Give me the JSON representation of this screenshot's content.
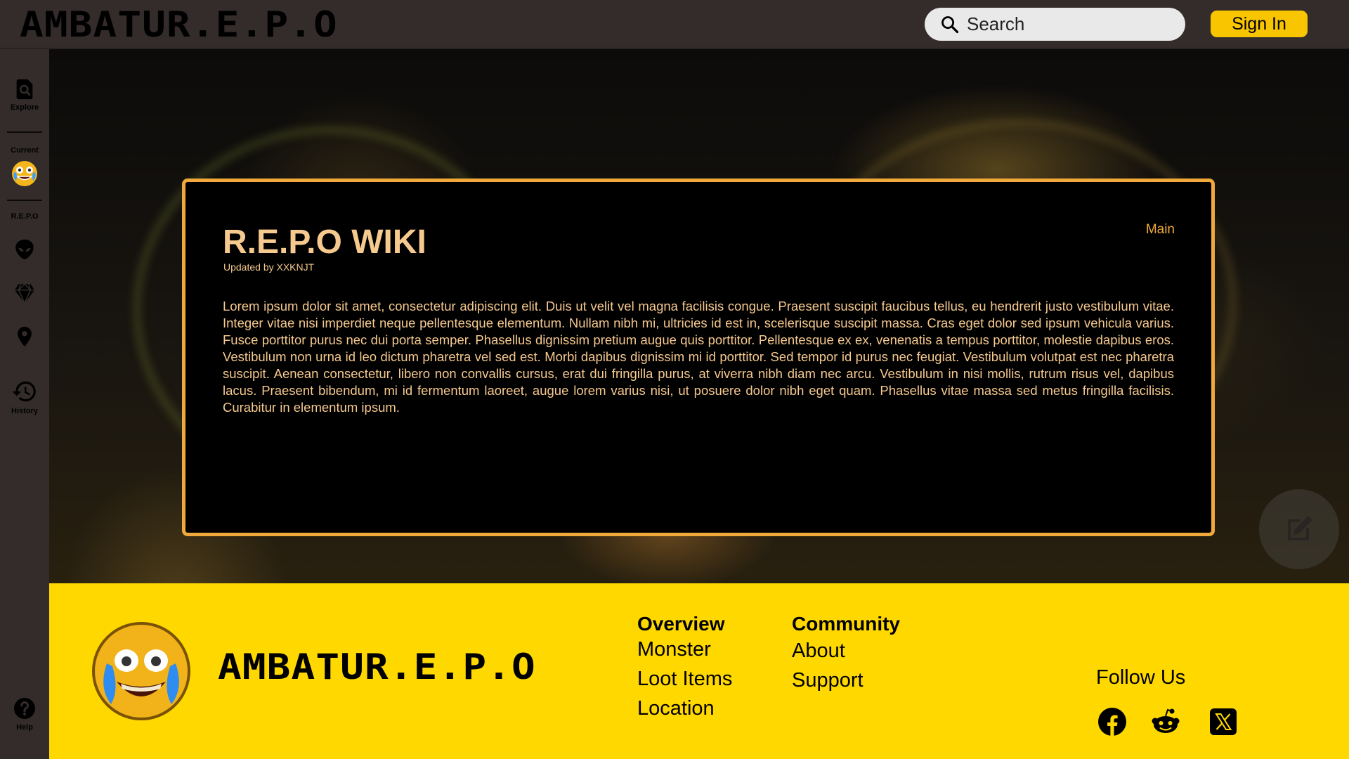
{
  "header": {
    "logo": "AMBATUR.E.P.O",
    "search_placeholder": "Search",
    "signin_label": "Sign In"
  },
  "sidebar": {
    "explore_label": "Explore",
    "current_heading": "Current",
    "repo_heading": "R.E.P.O",
    "history_label": "History",
    "help_label": "Help",
    "icons": [
      "search-icon",
      "crying-laughing-emoji",
      "alien-icon",
      "gem-icon",
      "location-pin-icon",
      "history-icon",
      "help-icon"
    ]
  },
  "wiki": {
    "title": "R.E.P.O WIKI",
    "updated_by": "Updated by XXKNJT",
    "tag": "Main",
    "body": "Lorem ipsum dolor sit amet, consectetur adipiscing elit. Duis ut velit vel magna facilisis congue. Praesent suscipit faucibus tellus, eu hendrerit justo vestibulum vitae. Integer vitae nisi imperdiet neque pellentesque elementum. Nullam nibh mi, ultricies id est in, scelerisque suscipit massa. Cras eget dolor sed ipsum vehicula varius. Fusce porttitor purus nec dui porta semper. Phasellus dignissim pretium augue quis porttitor. Pellentesque ex ex, venenatis a tempus porttitor, molestie dapibus eros. Vestibulum non urna id leo dictum pharetra vel sed est. Morbi dapibus dignissim mi id porttitor. Sed tempor id purus nec feugiat. Vestibulum volutpat est nec pharetra suscipit. Aenean consectetur, libero non convallis cursus, erat dui fringilla purus, at viverra nibh diam nec arcu. Vestibulum in nisi mollis, rutrum risus vel, dapibus lacus. Praesent bibendum, mi id fermentum laoreet, augue lorem varius nisi, ut posuere dolor nibh eget quam. Phasellus vitae massa sed metus fringilla facilisis. Curabitur in elementum ipsum."
  },
  "footer": {
    "logo": "AMBATUR.E.P.O",
    "overview": {
      "heading": "Overview",
      "links": [
        "Monster",
        "Loot Items",
        "Location"
      ]
    },
    "community": {
      "heading": "Community",
      "links": [
        "About",
        "Support"
      ]
    },
    "follow_label": "Follow Us",
    "social_icons": [
      "facebook-icon",
      "reddit-icon",
      "x-icon"
    ]
  },
  "colors": {
    "background": "#332c2b",
    "accent_yellow": "#ffd800",
    "signin_yellow": "#f9c400",
    "panel_border": "#f0a93a",
    "panel_text": "#f6c98e"
  }
}
